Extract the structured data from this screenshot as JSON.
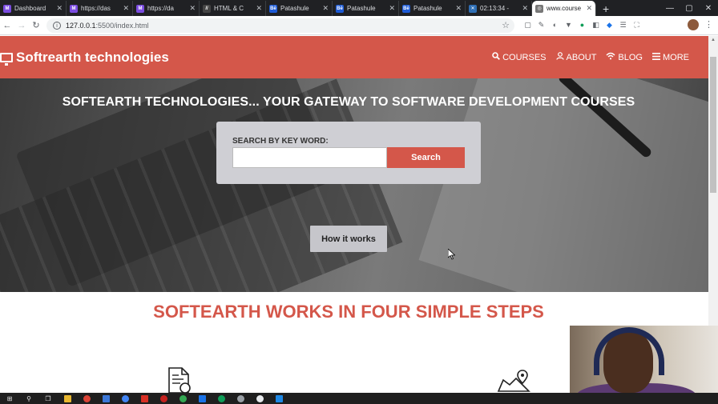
{
  "browser": {
    "tabs": [
      {
        "label": "Dashboard",
        "favicon_color": "#7b4ce0",
        "favicon": "M"
      },
      {
        "label": "https://das",
        "favicon_color": "#7b4ce0",
        "favicon": "M"
      },
      {
        "label": "https://da",
        "favicon_color": "#7b4ce0",
        "favicon": "M"
      },
      {
        "label": "HTML & C",
        "favicon_color": "#444",
        "favicon": "//"
      },
      {
        "label": "Patashule",
        "favicon_color": "#1d5bd6",
        "favicon": "Bē"
      },
      {
        "label": "Patashule",
        "favicon_color": "#1d5bd6",
        "favicon": "Bē"
      },
      {
        "label": "Patashule",
        "favicon_color": "#1d5bd6",
        "favicon": "Bē"
      },
      {
        "label": "02:13:34 -",
        "favicon_color": "#2f6fb5",
        "favicon": "✕"
      },
      {
        "label": "www.course",
        "favicon_color": "#777",
        "favicon": "◎",
        "active": true
      }
    ],
    "new_tab": "+",
    "url_host": "127.0.0.1",
    "url_path": ":5500/index.html",
    "window_controls": [
      "—",
      "▢",
      "✕"
    ]
  },
  "site": {
    "brand": "Softrearth technologies",
    "accent_color": "#d4574a",
    "nav": [
      {
        "label": "COURSES",
        "icon": "search-icon"
      },
      {
        "label": "ABOUT",
        "icon": "user-icon"
      },
      {
        "label": "BLOG",
        "icon": "wifi-icon"
      },
      {
        "label": "MORE",
        "icon": "menu-icon"
      }
    ],
    "hero_headline": "SOFTEARTH TECHNOLOGIES... YOUR GATEWAY TO SOFTWARE DEVELOPMENT COURSES",
    "search_label": "SEARCH BY KEY WORD:",
    "search_value": "",
    "search_button": "Search",
    "how_button": "How it works",
    "steps_title": "SOFTEARTH WORKS IN FOUR SIMPLE STEPS"
  }
}
